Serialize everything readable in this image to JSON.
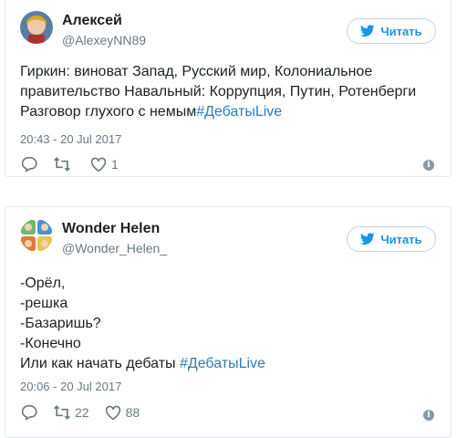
{
  "tweets": [
    {
      "name": "Алексей",
      "handle": "@AlexeyNN89",
      "follow_label": "Читать",
      "text_before": "Гиркин: виноват Запад, Русский мир, Колониальное\nправительство Навальный: Коррупция, Путин, Ротенберги\nРазговор глухого с немым",
      "hashtag": "#ДебатыLive",
      "timestamp": "20:43 - 20 Jul 2017",
      "retweets": "",
      "likes": "1"
    },
    {
      "name": "Wonder Helen",
      "handle": "@Wonder_Helen_",
      "follow_label": "Читать",
      "text_before": "-Орёл,\n-решка\n-Базаришь?\n-Конечно\nИли как начать дебаты ",
      "hashtag": "#ДебатыLive",
      "timestamp": "20:06 - 20 Jul 2017",
      "retweets": "22",
      "likes": "88"
    }
  ],
  "colors": {
    "accent": "#1b95e0",
    "hashtag": "#2b7bb9",
    "muted": "#697882",
    "border": "#e1e8ed"
  },
  "icons": {
    "follow": "twitter-bird-icon",
    "reply": "reply-icon",
    "retweet": "retweet-icon",
    "like": "heart-icon",
    "info": "info-icon"
  }
}
